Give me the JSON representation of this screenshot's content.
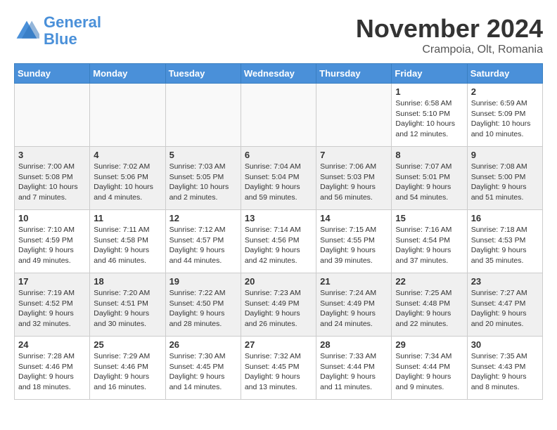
{
  "header": {
    "logo_general": "General",
    "logo_blue": "Blue",
    "month": "November 2024",
    "location": "Crampoia, Olt, Romania"
  },
  "weekdays": [
    "Sunday",
    "Monday",
    "Tuesday",
    "Wednesday",
    "Thursday",
    "Friday",
    "Saturday"
  ],
  "weeks": [
    [
      {
        "day": "",
        "info": ""
      },
      {
        "day": "",
        "info": ""
      },
      {
        "day": "",
        "info": ""
      },
      {
        "day": "",
        "info": ""
      },
      {
        "day": "",
        "info": ""
      },
      {
        "day": "1",
        "info": "Sunrise: 6:58 AM\nSunset: 5:10 PM\nDaylight: 10 hours and 12 minutes."
      },
      {
        "day": "2",
        "info": "Sunrise: 6:59 AM\nSunset: 5:09 PM\nDaylight: 10 hours and 10 minutes."
      }
    ],
    [
      {
        "day": "3",
        "info": "Sunrise: 7:00 AM\nSunset: 5:08 PM\nDaylight: 10 hours and 7 minutes."
      },
      {
        "day": "4",
        "info": "Sunrise: 7:02 AM\nSunset: 5:06 PM\nDaylight: 10 hours and 4 minutes."
      },
      {
        "day": "5",
        "info": "Sunrise: 7:03 AM\nSunset: 5:05 PM\nDaylight: 10 hours and 2 minutes."
      },
      {
        "day": "6",
        "info": "Sunrise: 7:04 AM\nSunset: 5:04 PM\nDaylight: 9 hours and 59 minutes."
      },
      {
        "day": "7",
        "info": "Sunrise: 7:06 AM\nSunset: 5:03 PM\nDaylight: 9 hours and 56 minutes."
      },
      {
        "day": "8",
        "info": "Sunrise: 7:07 AM\nSunset: 5:01 PM\nDaylight: 9 hours and 54 minutes."
      },
      {
        "day": "9",
        "info": "Sunrise: 7:08 AM\nSunset: 5:00 PM\nDaylight: 9 hours and 51 minutes."
      }
    ],
    [
      {
        "day": "10",
        "info": "Sunrise: 7:10 AM\nSunset: 4:59 PM\nDaylight: 9 hours and 49 minutes."
      },
      {
        "day": "11",
        "info": "Sunrise: 7:11 AM\nSunset: 4:58 PM\nDaylight: 9 hours and 46 minutes."
      },
      {
        "day": "12",
        "info": "Sunrise: 7:12 AM\nSunset: 4:57 PM\nDaylight: 9 hours and 44 minutes."
      },
      {
        "day": "13",
        "info": "Sunrise: 7:14 AM\nSunset: 4:56 PM\nDaylight: 9 hours and 42 minutes."
      },
      {
        "day": "14",
        "info": "Sunrise: 7:15 AM\nSunset: 4:55 PM\nDaylight: 9 hours and 39 minutes."
      },
      {
        "day": "15",
        "info": "Sunrise: 7:16 AM\nSunset: 4:54 PM\nDaylight: 9 hours and 37 minutes."
      },
      {
        "day": "16",
        "info": "Sunrise: 7:18 AM\nSunset: 4:53 PM\nDaylight: 9 hours and 35 minutes."
      }
    ],
    [
      {
        "day": "17",
        "info": "Sunrise: 7:19 AM\nSunset: 4:52 PM\nDaylight: 9 hours and 32 minutes."
      },
      {
        "day": "18",
        "info": "Sunrise: 7:20 AM\nSunset: 4:51 PM\nDaylight: 9 hours and 30 minutes."
      },
      {
        "day": "19",
        "info": "Sunrise: 7:22 AM\nSunset: 4:50 PM\nDaylight: 9 hours and 28 minutes."
      },
      {
        "day": "20",
        "info": "Sunrise: 7:23 AM\nSunset: 4:49 PM\nDaylight: 9 hours and 26 minutes."
      },
      {
        "day": "21",
        "info": "Sunrise: 7:24 AM\nSunset: 4:49 PM\nDaylight: 9 hours and 24 minutes."
      },
      {
        "day": "22",
        "info": "Sunrise: 7:25 AM\nSunset: 4:48 PM\nDaylight: 9 hours and 22 minutes."
      },
      {
        "day": "23",
        "info": "Sunrise: 7:27 AM\nSunset: 4:47 PM\nDaylight: 9 hours and 20 minutes."
      }
    ],
    [
      {
        "day": "24",
        "info": "Sunrise: 7:28 AM\nSunset: 4:46 PM\nDaylight: 9 hours and 18 minutes."
      },
      {
        "day": "25",
        "info": "Sunrise: 7:29 AM\nSunset: 4:46 PM\nDaylight: 9 hours and 16 minutes."
      },
      {
        "day": "26",
        "info": "Sunrise: 7:30 AM\nSunset: 4:45 PM\nDaylight: 9 hours and 14 minutes."
      },
      {
        "day": "27",
        "info": "Sunrise: 7:32 AM\nSunset: 4:45 PM\nDaylight: 9 hours and 13 minutes."
      },
      {
        "day": "28",
        "info": "Sunrise: 7:33 AM\nSunset: 4:44 PM\nDaylight: 9 hours and 11 minutes."
      },
      {
        "day": "29",
        "info": "Sunrise: 7:34 AM\nSunset: 4:44 PM\nDaylight: 9 hours and 9 minutes."
      },
      {
        "day": "30",
        "info": "Sunrise: 7:35 AM\nSunset: 4:43 PM\nDaylight: 9 hours and 8 minutes."
      }
    ]
  ]
}
